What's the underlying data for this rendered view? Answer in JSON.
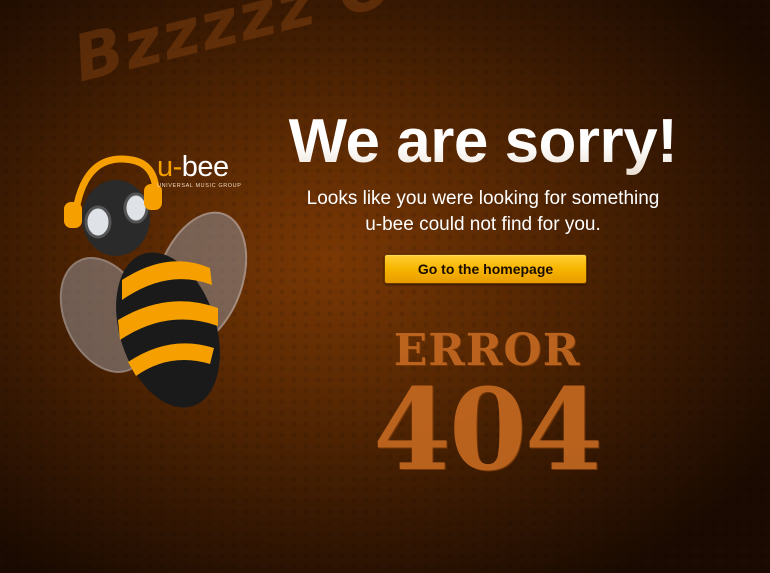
{
  "background_text": "Bzzzzz Ooops",
  "logo": {
    "main_prefix": "u-",
    "main_suffix": "bee",
    "sub": "UNIVERSAL MUSIC GROUP"
  },
  "title": "We are sorry!",
  "message": {
    "line1": "Looks like you were looking for something",
    "line2": "u-bee could not find for you."
  },
  "button": {
    "label": "Go to the homepage"
  },
  "error": {
    "word": "ERROR",
    "code": "404"
  },
  "colors": {
    "accent": "#f5a000",
    "background": "#4a2003",
    "error_text": "#c66a22"
  },
  "icons": {
    "mascot": "bee-with-headphones-icon"
  }
}
